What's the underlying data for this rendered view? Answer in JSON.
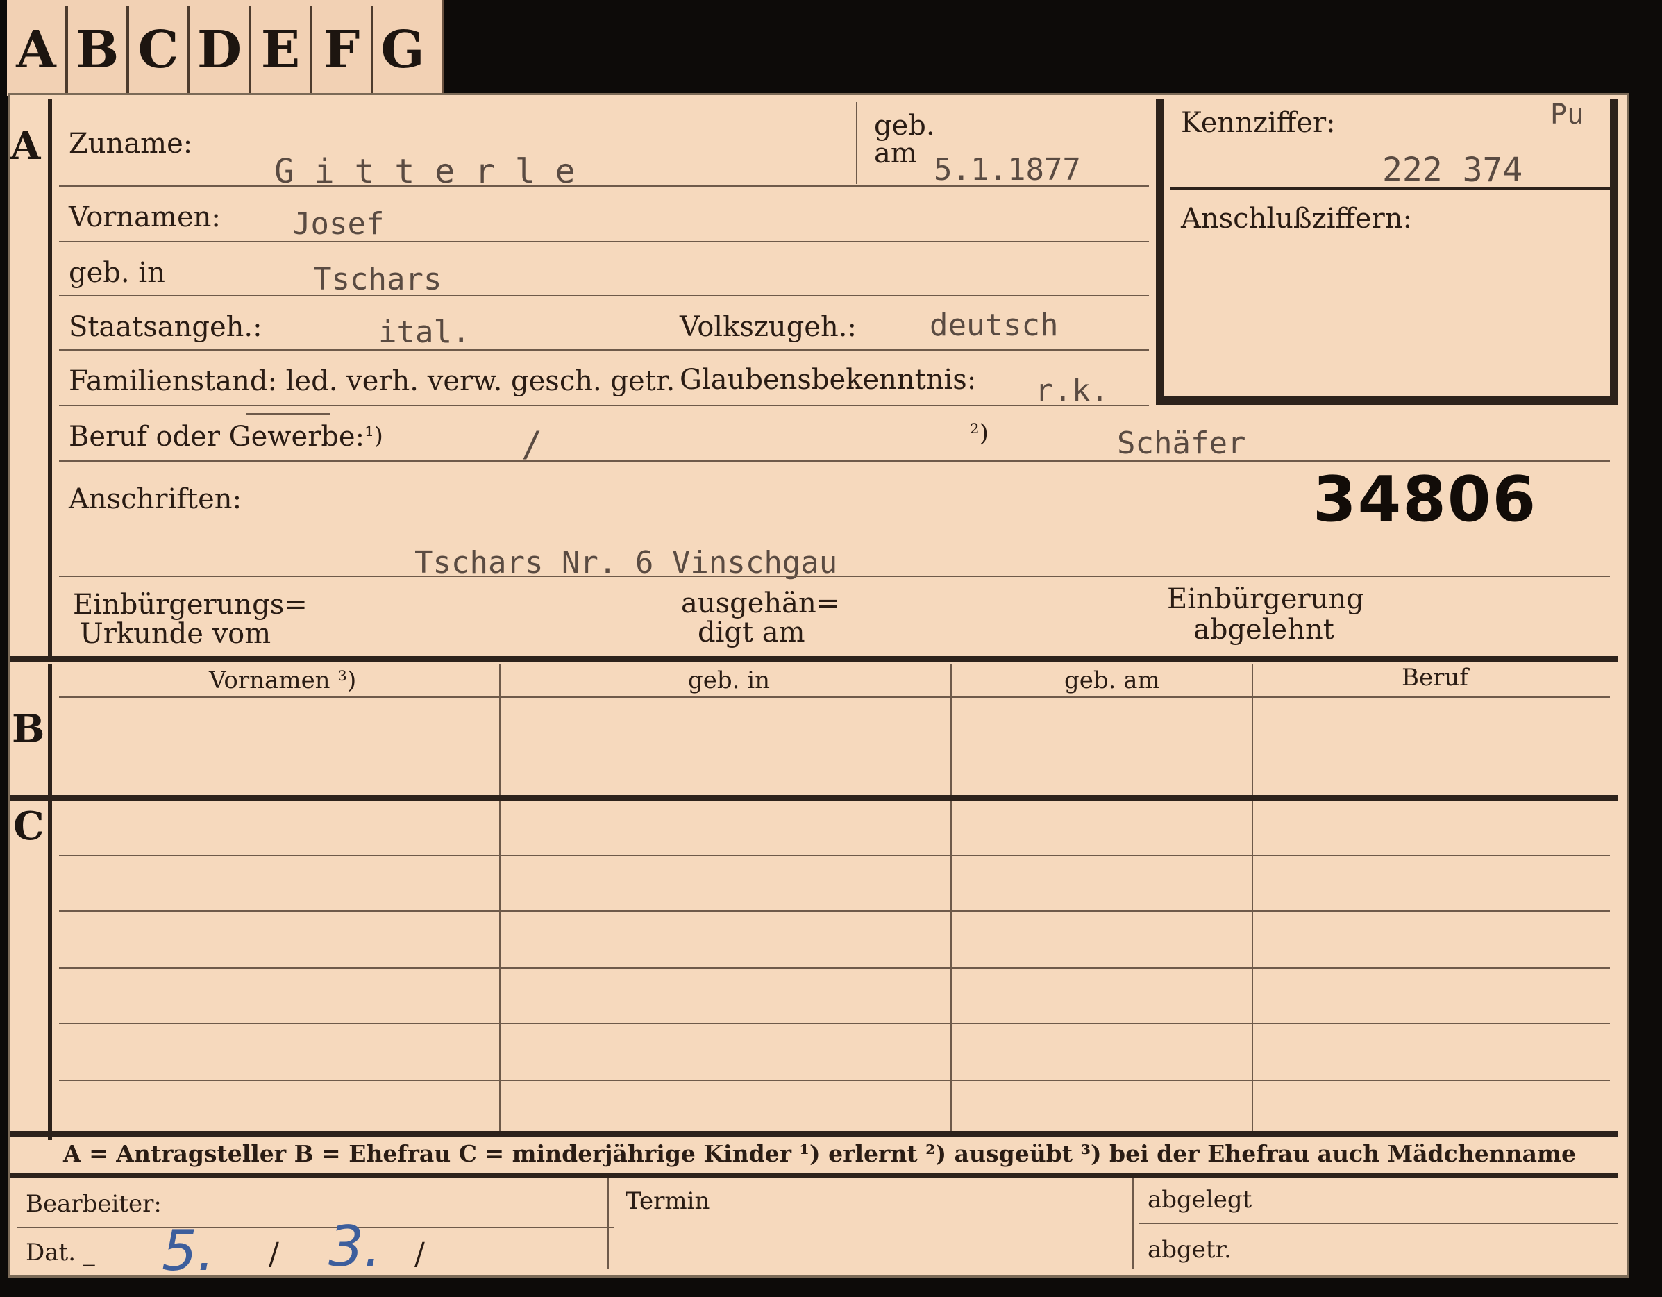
{
  "tabs": [
    "A",
    "B",
    "C",
    "D",
    "E",
    "F",
    "G"
  ],
  "section_labels": {
    "a": "A",
    "b": "B",
    "c": "C"
  },
  "fields": {
    "zuname_label": "Zuname:",
    "zuname_value": "G i t t e r l e",
    "geb_am_label_1": "geb.",
    "geb_am_label_2": "am",
    "geb_am_value": "5.1.1877",
    "kennziffer_label": "Kennziffer:",
    "kennziffer_mark": "Pu",
    "kennziffer_value": "222 374",
    "anschlussziffern_label": "Anschlußziffern:",
    "vornamen_label": "Vornamen:",
    "vornamen_value": "Josef",
    "geb_in_label": "geb. in",
    "geb_in_value": "Tschars",
    "staatsangeh_label": "Staatsangeh.:",
    "staatsangeh_value": "ital.",
    "volkszugeh_label": "Volkszugeh.:",
    "volkszugeh_value": "deutsch",
    "familienstand_label": "Familienstand: led. verh. verw. gesch. getr.",
    "glaubens_label": "Glaubensbekenntnis:",
    "glaubens_value": "r.k.",
    "beruf_label": "Beruf oder Gewerbe:",
    "beruf_note1": "¹)",
    "beruf_value1": "/",
    "beruf_note2": "²)",
    "beruf_value2": "Schäfer",
    "anschriften_label": "Anschriften:",
    "stamp_number": "34806",
    "anschrift_value": "Tschars Nr. 6 Vinschgau",
    "einb_urkunde_1": "Einbürgerungs=",
    "einb_urkunde_2": "Urkunde vom",
    "ausgeh_1": "ausgehän=",
    "ausgeh_2": "digt am",
    "einb_abgelehnt_1": "Einbürgerung",
    "einb_abgelehnt_2": "abgelehnt"
  },
  "table": {
    "headers": [
      "Vornamen ³)",
      "geb. in",
      "geb. am",
      "Beruf"
    ]
  },
  "legend": "A = Antragsteller   B = Ehefrau   C = minderjährige Kinder   ¹) erlernt   ²) ausgeübt   ³) bei der Ehefrau auch Mädchenname",
  "footer": {
    "bearbeiter_label": "Bearbeiter:",
    "dat_label": "Dat. _",
    "dat_day": "5.",
    "dat_sep1": "/",
    "dat_month": "3.",
    "dat_sep2": "/",
    "termin_label": "Termin",
    "abgelegt_label": "abgelegt",
    "abgetr_label": "abgetr."
  },
  "colors": {
    "card": "#f6d9bd",
    "ink": "#2a1c14",
    "typewriter": "#5a4b42",
    "handwriting": "#3d5e9c"
  }
}
